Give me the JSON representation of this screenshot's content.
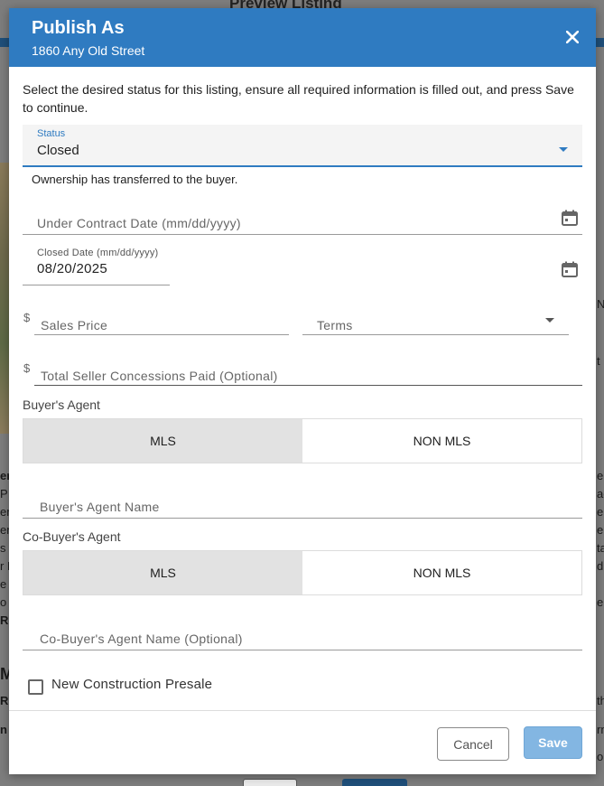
{
  "background": {
    "title": "Preview Listing",
    "left_fragments": [
      "er",
      "P",
      "en",
      "en",
      "s R",
      "r M",
      "e is",
      "o",
      "Re",
      "M",
      "R",
      "n"
    ],
    "right_fragments": [
      "N",
      "t",
      "er",
      "ac",
      "e",
      "e",
      "ta",
      "d",
      "e",
      "th",
      "rm",
      "ol"
    ]
  },
  "modal": {
    "title": "Publish As",
    "subtitle": "1860 Any Old Street",
    "close_label": "×",
    "intro": "Select the desired status for this listing, ensure all required information is filled out, and press Save to continue."
  },
  "status": {
    "label": "Status",
    "value": "Closed",
    "helper": "Ownership has transferred to the buyer."
  },
  "fields": {
    "under_contract_placeholder": "Under Contract Date (mm/dd/yyyy)",
    "closed_date_label": "Closed Date (mm/dd/yyyy)",
    "closed_date_value": "08/20/2025",
    "currency_symbol": "$",
    "sales_price_placeholder": "Sales Price",
    "terms_placeholder": "Terms",
    "concessions_placeholder": "Total Seller Concessions Paid (Optional)"
  },
  "buyers_agent": {
    "label": "Buyer's Agent",
    "options": [
      "MLS",
      "NON MLS"
    ],
    "selected": "MLS",
    "name_placeholder": "Buyer's Agent Name"
  },
  "co_buyers_agent": {
    "label": "Co-Buyer's Agent",
    "options": [
      "MLS",
      "NON MLS"
    ],
    "selected": "MLS",
    "name_placeholder": "Co-Buyer's Agent Name (Optional)"
  },
  "new_construction": {
    "label": "New Construction Presale",
    "checked": false
  },
  "footer": {
    "cancel_label": "Cancel",
    "save_label": "Save"
  },
  "colors": {
    "header": "#2f7bc1",
    "accent": "#2f7bc1",
    "save_button": "#83b6e2",
    "toggle_active": "#e2e2e2"
  },
  "icons": {
    "close": "close-icon",
    "calendar": "calendar-icon",
    "dropdown": "chevron-down-icon",
    "checkbox": "checkbox-icon"
  }
}
